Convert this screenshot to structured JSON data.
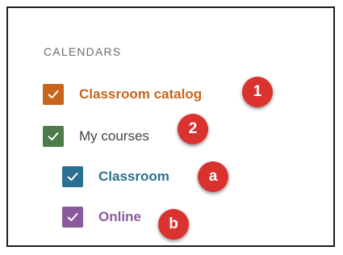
{
  "calendars": {
    "heading": "CALENDARS",
    "items": [
      {
        "label": "Classroom catalog",
        "checked": true,
        "color": "#c8651b",
        "icon": "check-icon"
      },
      {
        "label": "My courses",
        "checked": true,
        "color": "#4d7c4a",
        "icon": "check-icon"
      },
      {
        "label": "Classroom",
        "checked": true,
        "color": "#2a7191",
        "icon": "check-icon"
      },
      {
        "label": "Online",
        "checked": true,
        "color": "#8a5a9c",
        "icon": "check-icon"
      }
    ]
  },
  "callouts": [
    "1",
    "2",
    "a",
    "b"
  ],
  "callout_color": "#d9322f"
}
